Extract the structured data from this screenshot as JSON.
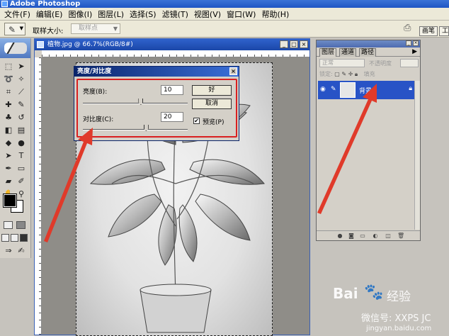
{
  "window": {
    "title": "Adobe Photoshop"
  },
  "menu": [
    "文件(F)",
    "编辑(E)",
    "图像(I)",
    "图层(L)",
    "选择(S)",
    "滤镜(T)",
    "视图(V)",
    "窗口(W)",
    "帮助(H)"
  ],
  "options_bar": {
    "sample_size_label": "取样大小:",
    "sample_size_value": "取样点",
    "tabs": [
      "画笔",
      "工"
    ]
  },
  "document": {
    "title": "植物.jpg @ 66.7%(RGB/8#)"
  },
  "dialog": {
    "title": "亮度/对比度",
    "brightness_label": "亮度(B):",
    "brightness_value": "10",
    "brightness_fraction": 0.55,
    "contrast_label": "对比度(C):",
    "contrast_value": "20",
    "contrast_fraction": 0.6,
    "ok_label": "好",
    "cancel_label": "取消",
    "preview_label": "预览(P)",
    "preview_checked": true
  },
  "layers_palette": {
    "tabs": [
      "图层",
      "通道",
      "路径"
    ],
    "blend_mode": "正常",
    "opacity_label": "不透明度",
    "fill_label": "填充",
    "lock_label": "锁定:",
    "layer_name": "背景"
  },
  "watermark": {
    "brand": "Bai",
    "brand_cn": "经验",
    "wechat": "微信号: XXPS JC",
    "url": "jingyan.baidu.com"
  },
  "colors": {
    "accent_red": "#e03a2a",
    "title_blue": "#1f55c4",
    "selected_layer": "#2853c6"
  }
}
